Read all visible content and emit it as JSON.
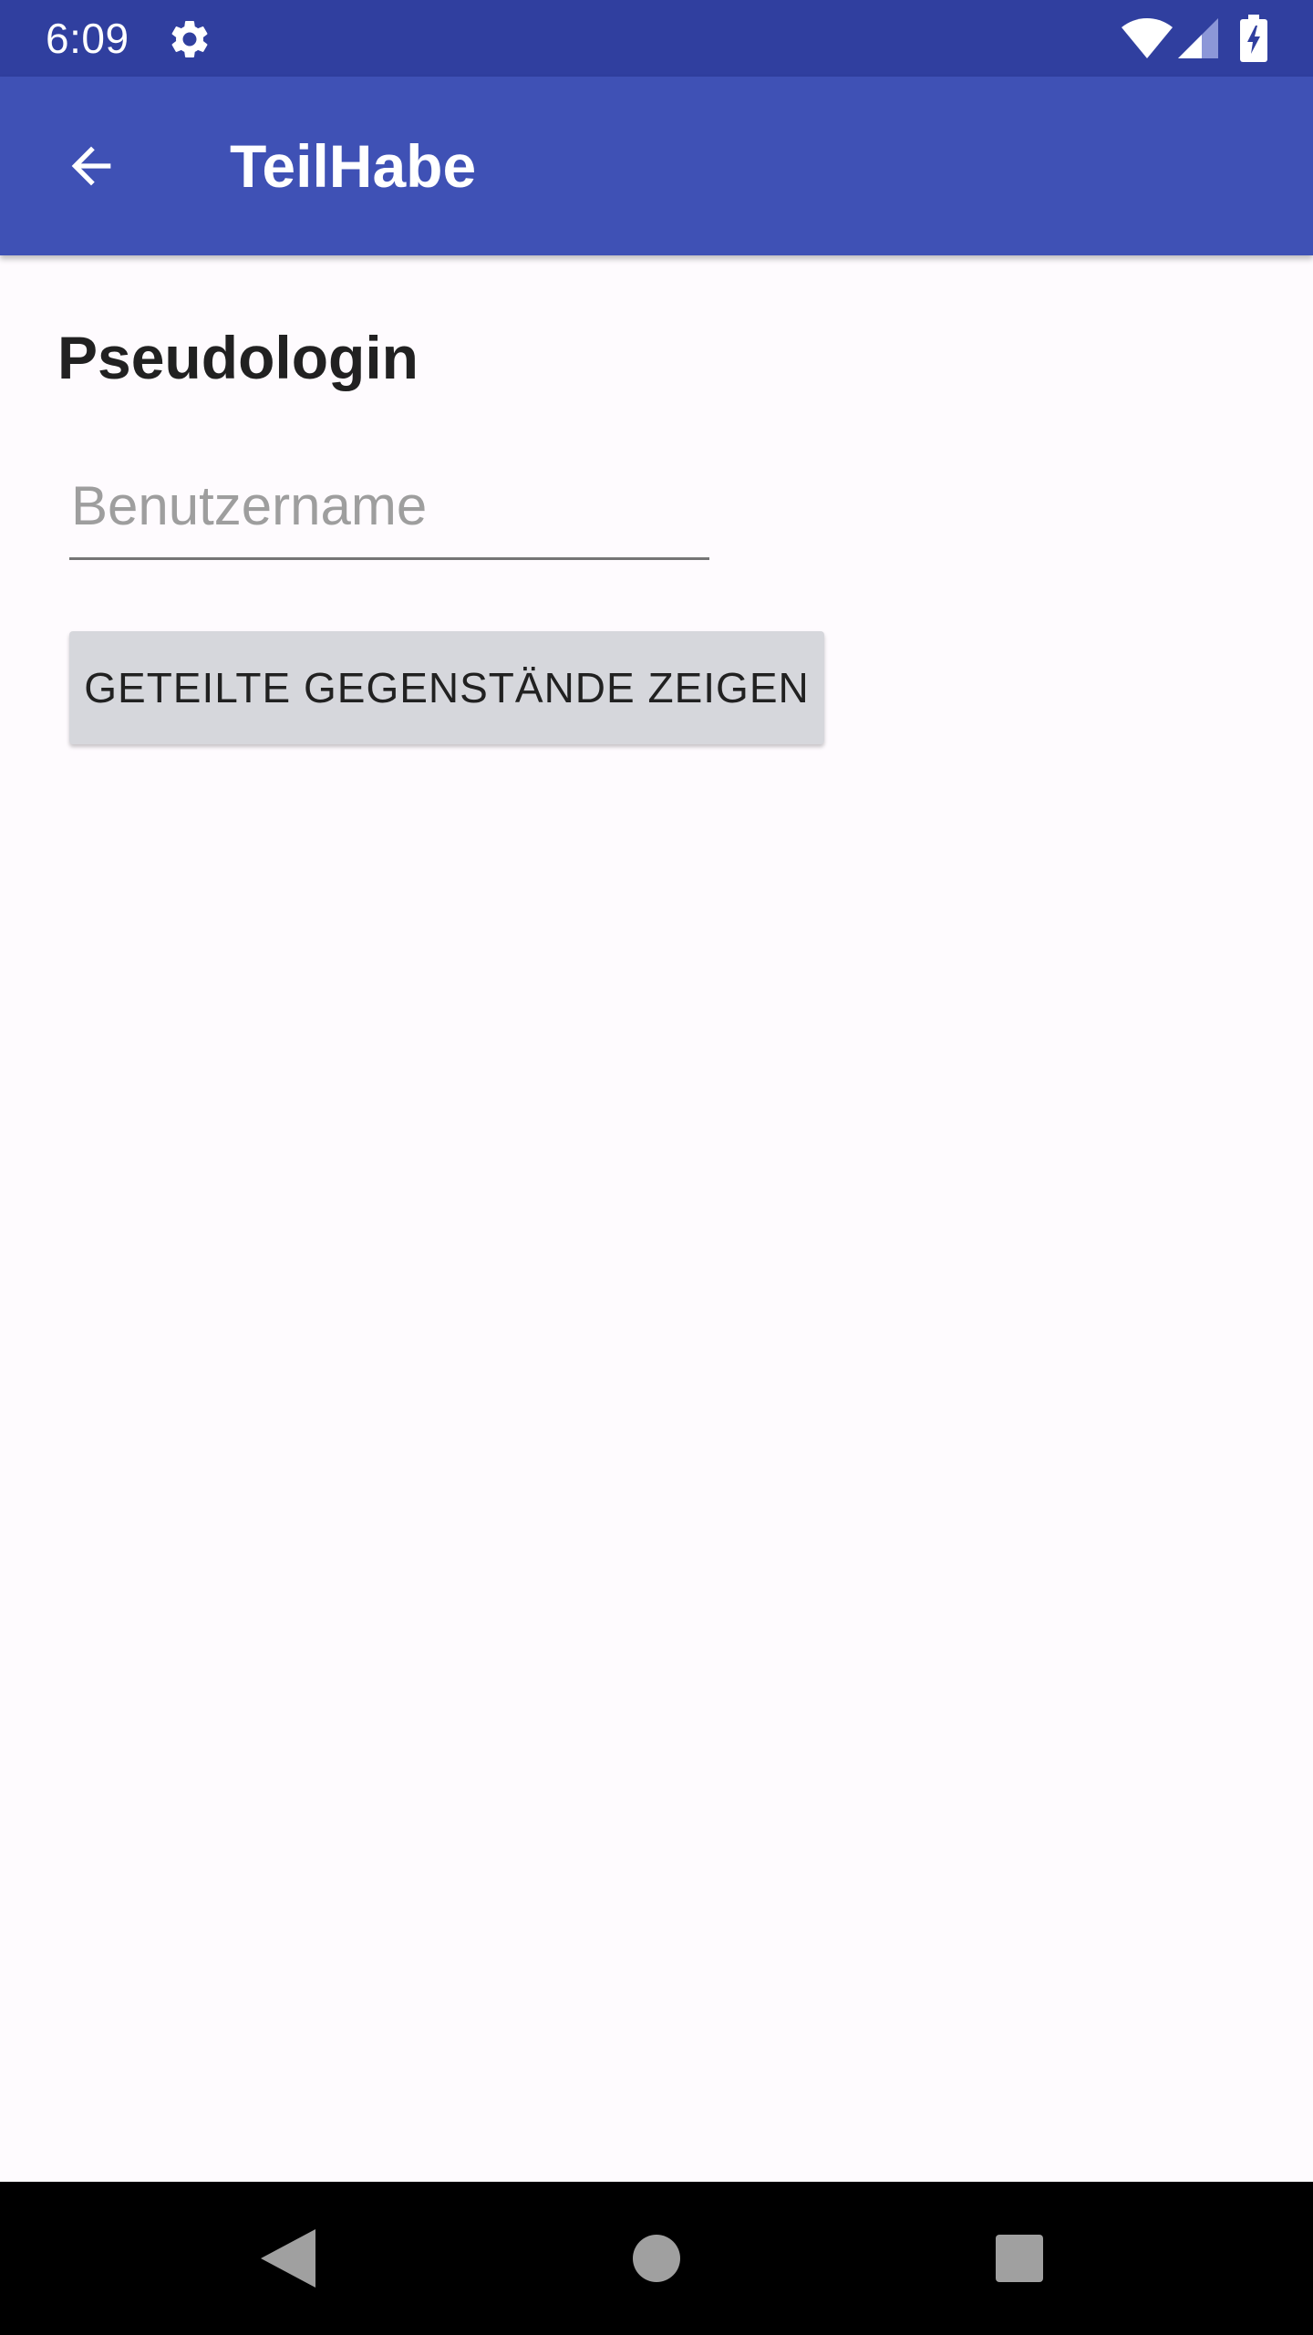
{
  "status_bar": {
    "time": "6:09",
    "icons": [
      "gear-icon",
      "wifi-icon",
      "signal-icon",
      "battery-charging-icon"
    ]
  },
  "app_bar": {
    "back_icon": "arrow-back-icon",
    "title": "TeilHabe"
  },
  "content": {
    "heading": "Pseudologin",
    "username_placeholder": "Benutzername",
    "username_value": "",
    "show_button_label": "GETEILTE GEGENSTÄNDE ZEIGEN"
  },
  "nav_bar": {
    "icons": [
      "nav-back-icon",
      "nav-home-icon",
      "nav-recents-icon"
    ]
  },
  "colors": {
    "status_bar": "#303f9f",
    "app_bar": "#3f51b5",
    "background": "#fefbfe",
    "button": "#d6d7dc",
    "nav_bar": "#000000"
  }
}
